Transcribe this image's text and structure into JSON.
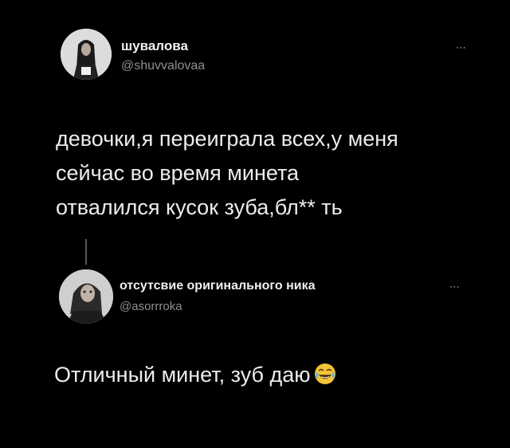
{
  "tweets": [
    {
      "display_name": "шувалова",
      "handle": "@shuvvalovaa",
      "more_icon": "⋯",
      "avatar_icon": "avatar-person-dark-hair",
      "text": "девочки,я переиграла всех,у меня\nсейчас во время минета\nотвалился кусок зуба,бл** ть"
    },
    {
      "display_name": "отсутсвие оригинального ника",
      "handle": "@asorrroka",
      "more_icon": "⋯",
      "avatar_icon": "avatar-person-long-hair",
      "text": "Отличный минет, зуб даю",
      "emoji": "face-with-tears-of-joy-icon"
    }
  ],
  "colors": {
    "background": "#000000",
    "text": "#ececec",
    "secondary": "#8f8f8f",
    "emoji_yellow": "#f5c537"
  }
}
